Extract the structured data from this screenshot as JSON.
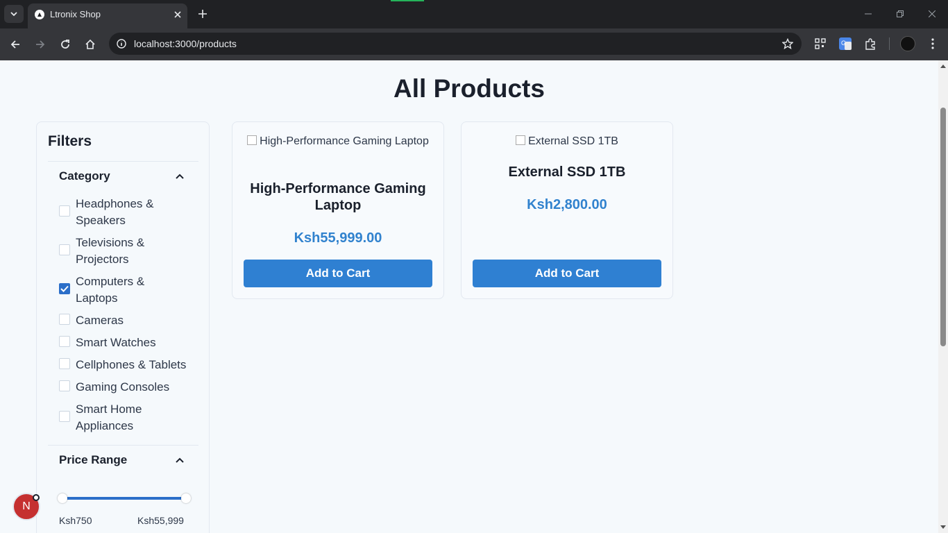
{
  "browser": {
    "tab_title": "Ltronix Shop",
    "url": "localhost:3000/products",
    "icons": [
      "tab-search-icon",
      "close-icon",
      "plus-icon",
      "minimize-icon",
      "restore-icon",
      "close-window-icon",
      "back-arrow-icon",
      "forward-arrow-icon",
      "reload-icon",
      "home-icon",
      "site-info-icon",
      "star-icon",
      "qr-code-icon",
      "translate-icon",
      "extensions-icon",
      "menu-dots-icon"
    ]
  },
  "page": {
    "title": "All Products"
  },
  "filters": {
    "title": "Filters",
    "category": {
      "heading": "Category",
      "items": [
        {
          "label": "Headphones & Speakers",
          "checked": false
        },
        {
          "label": "Televisions & Projectors",
          "checked": false
        },
        {
          "label": "Computers & Laptops",
          "checked": true
        },
        {
          "label": "Cameras",
          "checked": false
        },
        {
          "label": "Smart Watches",
          "checked": false
        },
        {
          "label": "Cellphones & Tablets",
          "checked": false
        },
        {
          "label": "Gaming Consoles",
          "checked": false
        },
        {
          "label": "Smart Home Appliances",
          "checked": false
        }
      ]
    },
    "price_range": {
      "heading": "Price Range",
      "min_label": "Ksh750",
      "max_label": "Ksh55,999"
    }
  },
  "products": [
    {
      "image_alt": "High-Performance Gaming Laptop",
      "name": "High-Performance Gaming Laptop",
      "price": "Ksh55,999.00",
      "button": "Add to Cart"
    },
    {
      "image_alt": "External SSD 1TB",
      "name": "External SSD 1TB",
      "price": "Ksh2,800.00",
      "button": "Add to Cart"
    }
  ],
  "dev_badge": {
    "letter": "N"
  },
  "colors": {
    "accent": "#2f80d2",
    "price": "#3182ce",
    "title": "#1a202c"
  }
}
